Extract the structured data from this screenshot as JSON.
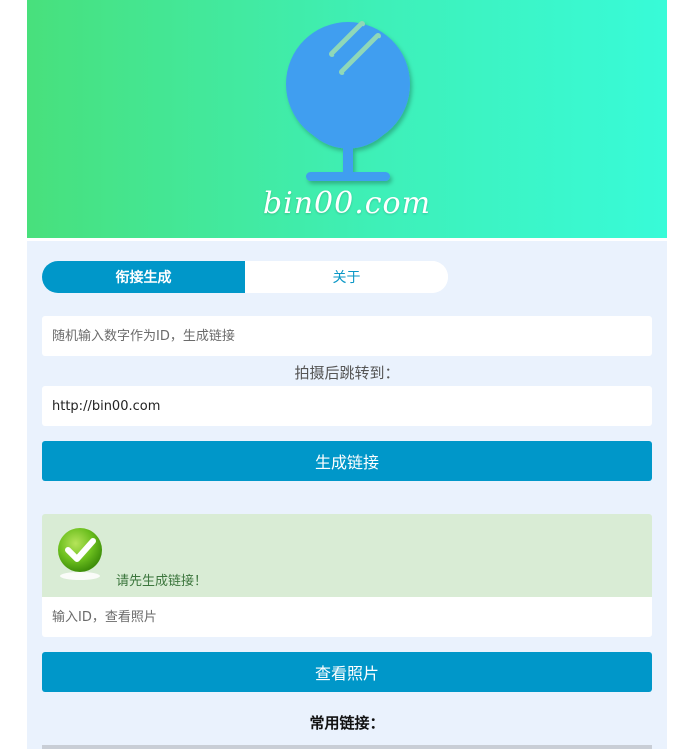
{
  "banner": {
    "brand_text": "bin00.com",
    "logo_icon": "mirror-icon",
    "gradient_left": "#48e07c",
    "gradient_right": "#38fbd8",
    "logo_color": "#3f9ef0"
  },
  "tabs": [
    {
      "label": "衔接生成",
      "active": true
    },
    {
      "label": "关于",
      "active": false
    }
  ],
  "generator": {
    "id_placeholder": "随机输入数字作为ID，生成链接",
    "redirect_label": "拍摄后跳转到：",
    "redirect_value": "http://bin00.com",
    "generate_button": "生成链接"
  },
  "alert": {
    "icon": "check-icon",
    "message": "请先生成链接！"
  },
  "viewer": {
    "id_placeholder": "输入ID，查看照片",
    "view_button": "查看照片"
  },
  "links": {
    "heading": "常用链接："
  },
  "colors": {
    "accent": "#0097c9",
    "page_bg": "#eaf2fd",
    "alert_bg": "#d9ecd5",
    "alert_text": "#3c763d"
  }
}
